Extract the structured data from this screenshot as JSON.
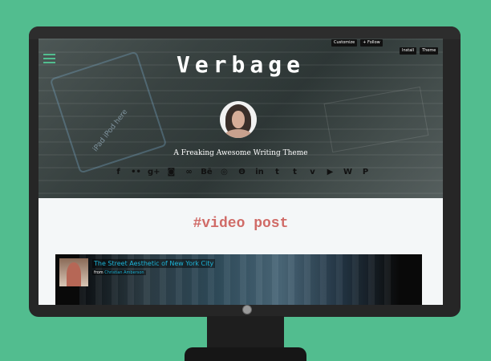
{
  "site": {
    "title": "Verbage",
    "tagline": "A Freaking Awesome Writing Theme"
  },
  "toolbar": {
    "customize_label": "Customize",
    "follow_label": "+ Follow",
    "install_label": "Install",
    "theme_label": "Theme"
  },
  "social": {
    "icons": [
      {
        "name": "facebook-icon",
        "glyph": "f"
      },
      {
        "name": "flickr-icon",
        "glyph": "••"
      },
      {
        "name": "google-plus-icon",
        "glyph": "g+"
      },
      {
        "name": "instagram-icon",
        "glyph": "◙"
      },
      {
        "name": "lastfm-icon",
        "glyph": "∞"
      },
      {
        "name": "behance-icon",
        "glyph": "Bē"
      },
      {
        "name": "dribbble-icon",
        "glyph": "◎"
      },
      {
        "name": "deviantart-icon",
        "glyph": "Θ"
      },
      {
        "name": "linkedin-icon",
        "glyph": "in"
      },
      {
        "name": "tumblr-icon",
        "glyph": "t"
      },
      {
        "name": "twitter-icon",
        "glyph": "t"
      },
      {
        "name": "vimeo-icon",
        "glyph": "v"
      },
      {
        "name": "youtube-icon",
        "glyph": "▶"
      },
      {
        "name": "wordpress-icon",
        "glyph": "W"
      },
      {
        "name": "pinterest-icon",
        "glyph": "P"
      }
    ]
  },
  "post": {
    "tag_title": "#video post",
    "video": {
      "title": "The Street Aesthetic of New York City",
      "from_prefix": "from",
      "author": "Christian Amberson"
    }
  },
  "colors": {
    "background": "#52bd8f",
    "accent": "#d06b67",
    "link": "#1cb5d9"
  },
  "decor": {
    "ipad_label": "iPad iPod here"
  }
}
